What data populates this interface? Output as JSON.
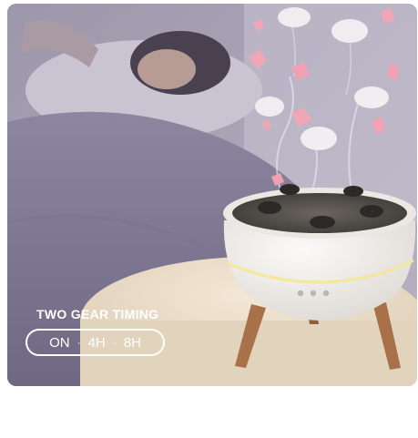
{
  "caption": {
    "title": "TWO GEAR TIMING",
    "options": [
      "ON",
      "4H",
      "8H"
    ],
    "separator": "·"
  },
  "scene": {
    "subject": "white-diffuser-icon",
    "colors": {
      "wall": "#a9a2b4",
      "bed": "#8a829a",
      "table": "#e9dcc9",
      "diffuser": "#f1efec",
      "light_ring": "#f5e79a",
      "leg": "#a8714a",
      "petal": "#f2a7b8"
    }
  }
}
